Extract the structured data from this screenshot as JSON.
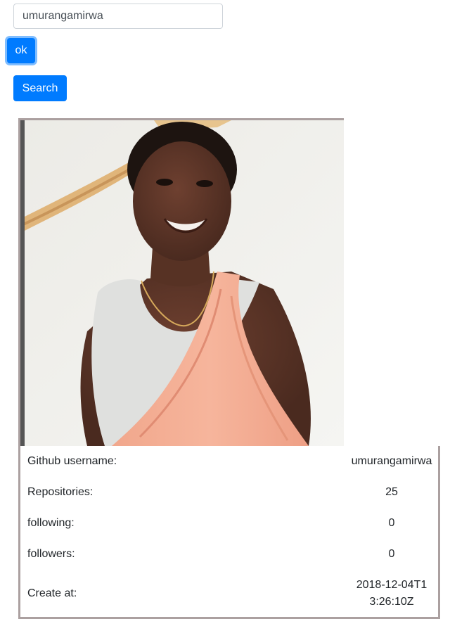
{
  "search": {
    "value": "umurangamirwa"
  },
  "buttons": {
    "ok_label": "ok",
    "search_label": "Search"
  },
  "profile": {
    "rows": [
      {
        "label": "Github username:",
        "value": "umurangamirwa"
      },
      {
        "label": "Repositories:",
        "value": "25"
      },
      {
        "label": "following:",
        "value": "0"
      },
      {
        "label": "followers:",
        "value": "0"
      },
      {
        "label": "Create at:",
        "value": "2018-12-04T13:26:10Z"
      }
    ]
  },
  "colors": {
    "primary": "#007bff",
    "card_border": "#aba0a0"
  }
}
